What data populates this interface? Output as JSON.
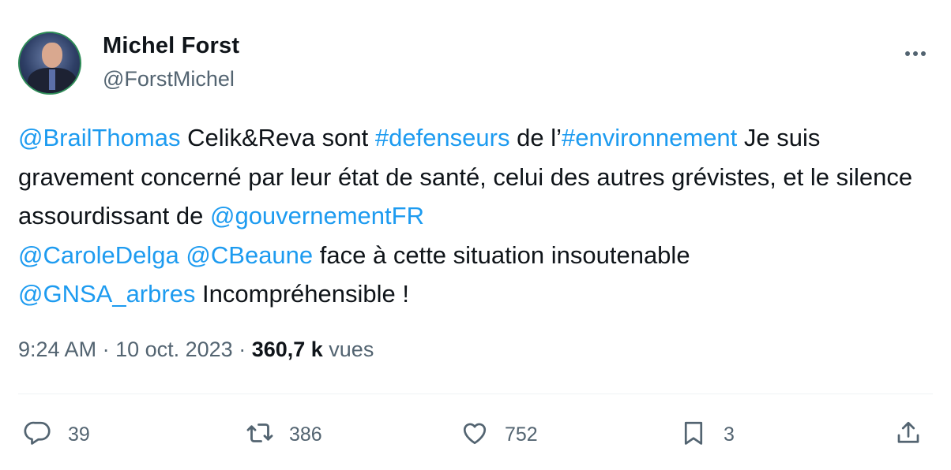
{
  "author": {
    "name": "Michel Forst",
    "handle": "@ForstMichel"
  },
  "tweet": {
    "segments": [
      {
        "text": "@BrailThomas",
        "type": "mention"
      },
      {
        "text": " Celik&Reva sont ",
        "type": "text"
      },
      {
        "text": "#defenseurs",
        "type": "hashtag"
      },
      {
        "text": " de l’",
        "type": "text"
      },
      {
        "text": "#environnement",
        "type": "hashtag"
      },
      {
        "text": " Je suis gravement concerné par leur état de santé, celui des autres grévistes, et le silence assourdissant de ",
        "type": "text"
      },
      {
        "text": "@gouvernementFR",
        "type": "mention"
      },
      {
        "text": " ",
        "type": "text"
      },
      {
        "text": "@CaroleDelga",
        "type": "mention"
      },
      {
        "text": " ",
        "type": "text"
      },
      {
        "text": "@CBeaune",
        "type": "mention"
      },
      {
        "text": " face à cette situation insoutenable ",
        "type": "text"
      },
      {
        "text": "@GNSA_arbres",
        "type": "mention"
      },
      {
        "text": " Incompréhensible !",
        "type": "text"
      }
    ]
  },
  "meta": {
    "time": "9:24 AM",
    "separator": " · ",
    "date": "10 oct. 2023",
    "views_count": "360,7 k",
    "views_label": " vues"
  },
  "actions": {
    "replies": "39",
    "reposts": "386",
    "likes": "752",
    "bookmarks": "3"
  },
  "icons": {
    "reply": "reply-icon",
    "repost": "repost-icon",
    "like": "heart-icon",
    "bookmark": "bookmark-icon",
    "share": "share-icon",
    "more": "more-icon"
  },
  "colors": {
    "link": "#1d9bf0",
    "secondary_text": "#536471",
    "primary_text": "#0f1419"
  }
}
